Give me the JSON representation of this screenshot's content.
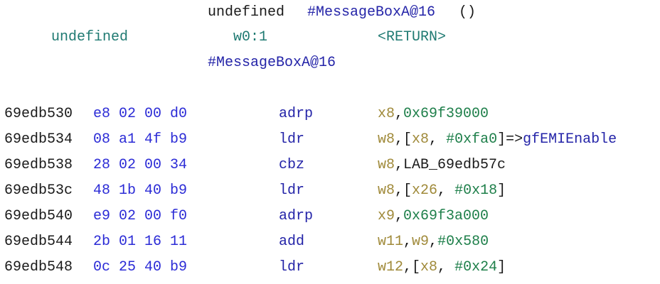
{
  "function_header": {
    "signature": {
      "return_type": "undefined",
      "name": "#MessageBoxA@16",
      "parens": "()"
    },
    "return_info": {
      "type": "undefined",
      "storage": "w0:1",
      "label": "<RETURN>"
    },
    "label": "#MessageBoxA@16"
  },
  "instructions": [
    {
      "address": "69edb530",
      "bytes": "e8 02 00 d0",
      "mnemonic": "adrp",
      "operands": [
        {
          "text": "x8",
          "kind": "register"
        },
        {
          "text": ",",
          "kind": "punct"
        },
        {
          "text": "0x69f39000",
          "kind": "number"
        }
      ]
    },
    {
      "address": "69edb534",
      "bytes": "08 a1 4f b9",
      "mnemonic": "ldr",
      "operands": [
        {
          "text": "w8",
          "kind": "register"
        },
        {
          "text": ",[",
          "kind": "punct"
        },
        {
          "text": "x8",
          "kind": "register"
        },
        {
          "text": ", ",
          "kind": "punct"
        },
        {
          "text": "#0xfa0",
          "kind": "number"
        },
        {
          "text": "]=>",
          "kind": "punct"
        },
        {
          "text": "gfEMIEnable",
          "kind": "ref"
        }
      ]
    },
    {
      "address": "69edb538",
      "bytes": "28 02 00 34",
      "mnemonic": "cbz",
      "operands": [
        {
          "text": "w8",
          "kind": "register"
        },
        {
          "text": ",LAB_69edb57c",
          "kind": "label"
        }
      ]
    },
    {
      "address": "69edb53c",
      "bytes": "48 1b 40 b9",
      "mnemonic": "ldr",
      "operands": [
        {
          "text": "w8",
          "kind": "register"
        },
        {
          "text": ",[",
          "kind": "punct"
        },
        {
          "text": "x26",
          "kind": "register"
        },
        {
          "text": ", ",
          "kind": "punct"
        },
        {
          "text": "#0x18",
          "kind": "number"
        },
        {
          "text": "]",
          "kind": "punct"
        }
      ]
    },
    {
      "address": "69edb540",
      "bytes": "e9 02 00 f0",
      "mnemonic": "adrp",
      "operands": [
        {
          "text": "x9",
          "kind": "register"
        },
        {
          "text": ",",
          "kind": "punct"
        },
        {
          "text": "0x69f3a000",
          "kind": "number"
        }
      ]
    },
    {
      "address": "69edb544",
      "bytes": "2b 01 16 11",
      "mnemonic": "add",
      "operands": [
        {
          "text": "w11",
          "kind": "register"
        },
        {
          "text": ",",
          "kind": "punct"
        },
        {
          "text": "w9",
          "kind": "register"
        },
        {
          "text": ",",
          "kind": "punct"
        },
        {
          "text": "#0x580",
          "kind": "number"
        }
      ]
    },
    {
      "address": "69edb548",
      "bytes": "0c 25 40 b9",
      "mnemonic": "ldr",
      "operands": [
        {
          "text": "w12",
          "kind": "register"
        },
        {
          "text": ",[",
          "kind": "punct"
        },
        {
          "text": "x8",
          "kind": "register"
        },
        {
          "text": ", ",
          "kind": "punct"
        },
        {
          "text": "#0x24",
          "kind": "number"
        },
        {
          "text": "]",
          "kind": "punct"
        }
      ]
    }
  ],
  "colors": {
    "address": "#1a1a1a",
    "bytes": "#2b2bd6",
    "mnemonic": "#2424a8",
    "register": "#a08a3a",
    "number": "#1e7f4a",
    "punct": "#1a1a1a",
    "ref": "#2424a8",
    "label": "#1a1a1a",
    "type": "#1f7a72"
  }
}
